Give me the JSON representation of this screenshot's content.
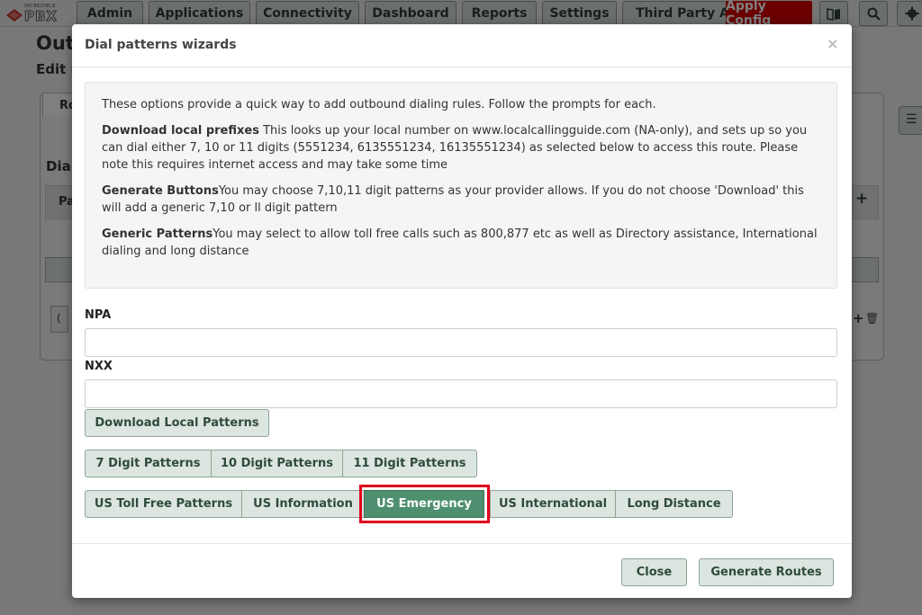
{
  "brand": {
    "small": "INCREDIBLE",
    "word": "PBX"
  },
  "nav": {
    "items": [
      "Admin",
      "Applications",
      "Connectivity",
      "Dashboard",
      "Reports",
      "Settings",
      "Third Party Addon"
    ],
    "apply_config": "Apply Config"
  },
  "icons": {
    "user_manual": "book-icon",
    "search": "search-icon",
    "settings": "gear-icon"
  },
  "background": {
    "title": "Out",
    "subtitle": "Edit R",
    "tab": "Ro",
    "section": "Dial",
    "row_label": "Pa",
    "field_prefix": "("
  },
  "modal": {
    "title": "Dial patterns wizards",
    "close_glyph": "×",
    "intro": "These options provide a quick way to add outbound dialing rules. Follow the prompts for each.",
    "download": {
      "heading": "Download local prefixes",
      "text": " This looks up your local number on www.localcallingguide.com (NA-only), and sets up so you can dial either 7, 10 or 11 digits (5551234, 6135551234, 16135551234) as selected below to access this route. Please note this requires internet access and may take some time"
    },
    "generate": {
      "heading": "Generate Buttons",
      "text": "You may choose 7,10,11 digit patterns as your provider allows. If you do not choose 'Download' this will add a generic 7,10 or ll digit pattern"
    },
    "generic": {
      "heading": "Generic Patterns",
      "text": "You may select to allow toll free calls such as 800,877 etc as well as Directory assistance, International dialing and long distance"
    },
    "npa_label": "NPA",
    "npa_value": "",
    "nxx_label": "NXX",
    "nxx_value": "",
    "download_button": "Download Local Patterns",
    "digit_buttons": [
      "7 Digit Patterns",
      "10 Digit Patterns",
      "11 Digit Patterns"
    ],
    "generic_buttons": [
      "US Toll Free Patterns",
      "US Information",
      "US Emergency",
      "US International",
      "Long Distance"
    ],
    "active_generic": "US Emergency",
    "close_button": "Close",
    "generate_button": "Generate Routes"
  },
  "colors": {
    "apply_config_bg": "#d40000",
    "button_bg": "#dce5df",
    "active_button_bg": "#4e8f6f",
    "highlight_outline": "#e0001b"
  }
}
